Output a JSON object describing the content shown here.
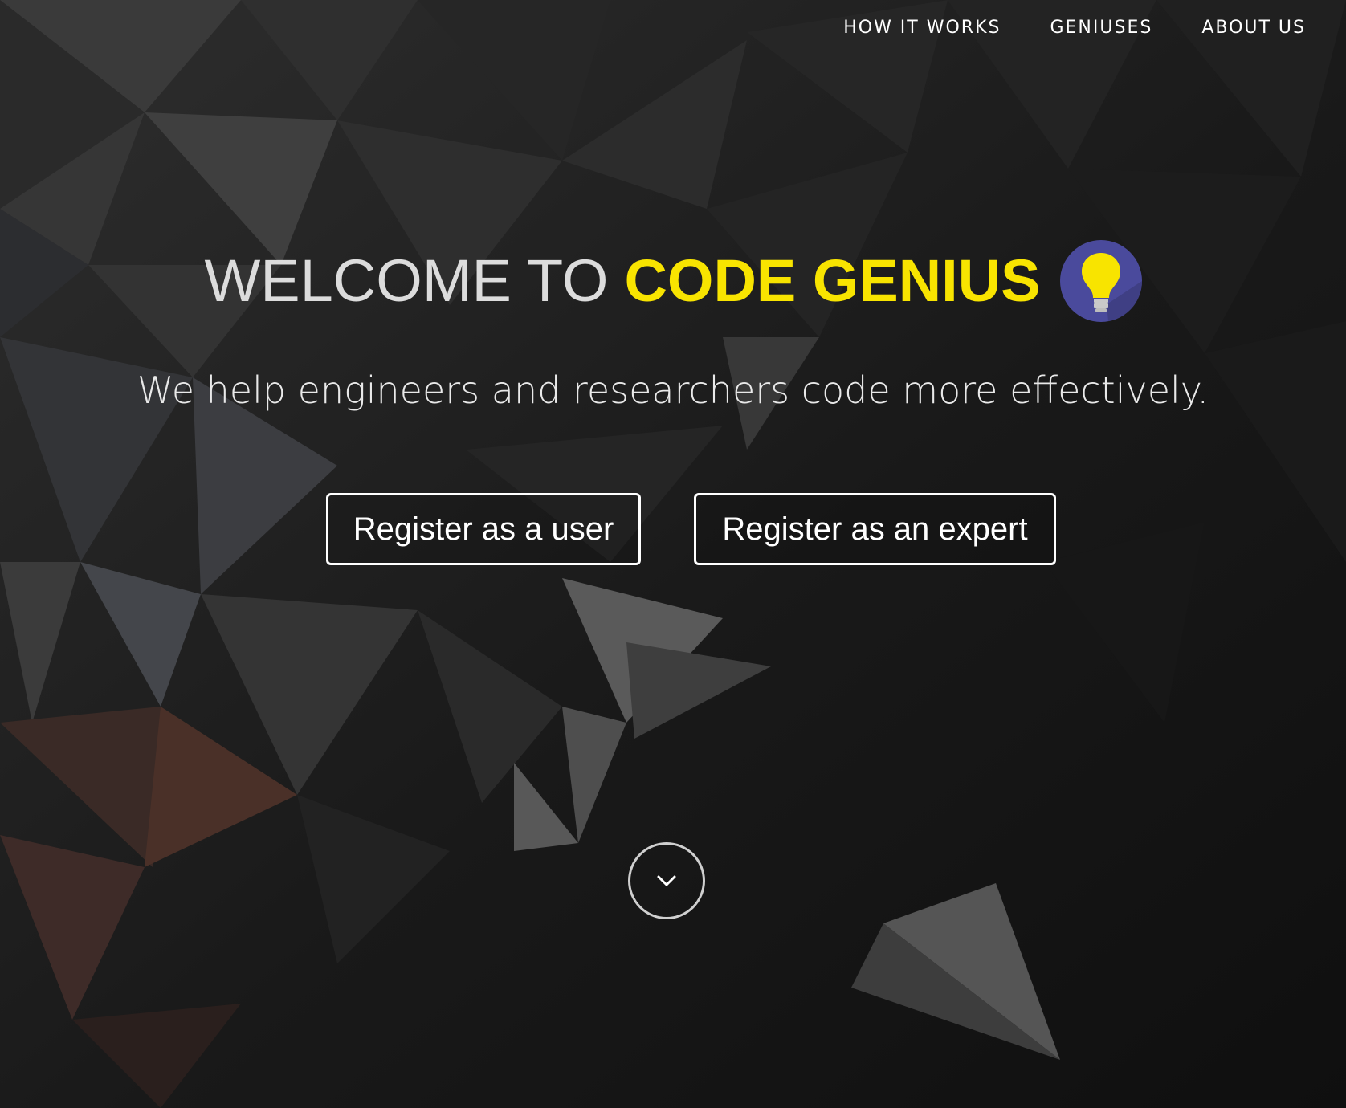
{
  "nav": {
    "items": [
      {
        "label": "HOW IT WORKS"
      },
      {
        "label": "GENIUSES"
      },
      {
        "label": "ABOUT US"
      }
    ]
  },
  "hero": {
    "title_prefix": "WELCOME TO",
    "title_brand": "CODE GENIUS",
    "subtitle": "We help engineers and researchers code more effectively.",
    "register_user": "Register as a user",
    "register_expert": "Register as an expert"
  },
  "icons": {
    "logo": "lightbulb-icon",
    "scroll": "chevron-down-icon"
  },
  "colors": {
    "brand_yellow": "#f8e400",
    "logo_circle": "#4a4a9c",
    "background": "#141414"
  }
}
